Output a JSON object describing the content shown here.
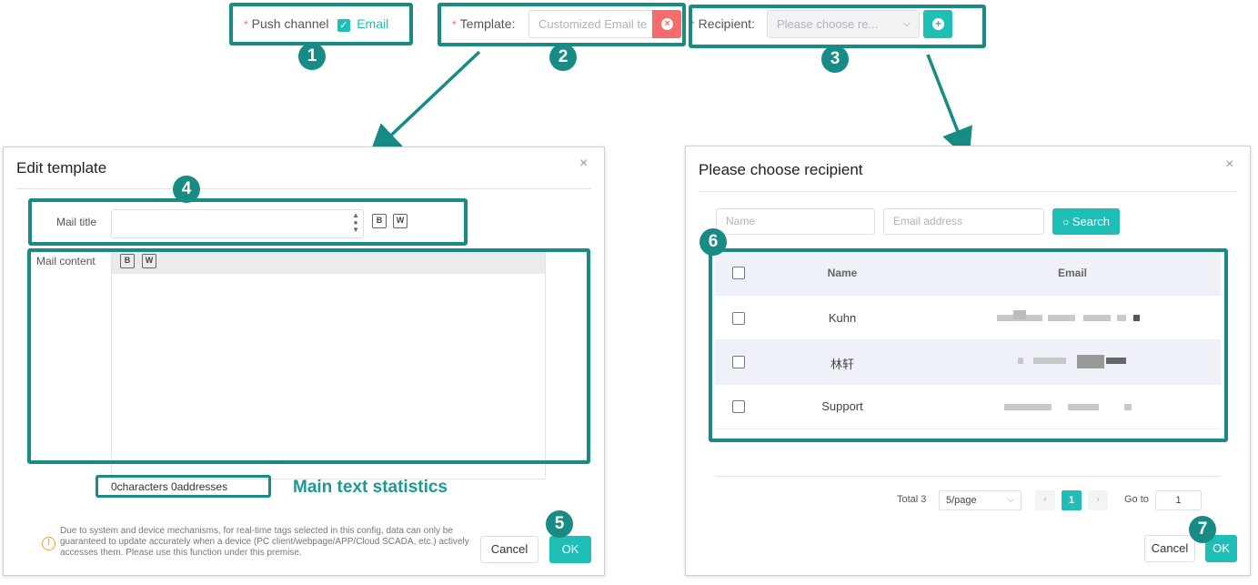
{
  "top": {
    "push_channel_label": "Push channel",
    "email_option": "Email",
    "template_label": "Template:",
    "template_value": "Customized Email te",
    "recipient_label": "Recipient:",
    "recipient_placeholder": "Please choose re...",
    "required_mark": "*"
  },
  "badges": [
    "1",
    "2",
    "3",
    "4",
    "5",
    "6",
    "7"
  ],
  "edit_template": {
    "title": "Edit template",
    "mail_title_label": "Mail title",
    "mail_content_label": "Mail content",
    "stats_text": "0characters 0addresses",
    "stats_caption": "Main text statistics",
    "notice": "Due to system and device mechanisms, for real-time tags selected in this config, data can only be guaranteed to update accurately when a device (PC client/webpage/APP/Cloud SCADA, etc.) actively accesses them. Please use this function under this premise.",
    "cancel": "Cancel",
    "ok": "OK",
    "close_glyph": "×",
    "tag_icon_text": "B",
    "web_icon_text": "W"
  },
  "recipient_dialog": {
    "title": "Please choose recipient",
    "name_placeholder": "Name",
    "email_placeholder": "Email address",
    "search": "Search",
    "columns": [
      "Name",
      "Email"
    ],
    "rows": [
      {
        "name": "Kuhn"
      },
      {
        "name": "林轩"
      },
      {
        "name": "Support"
      }
    ],
    "total": "Total 3",
    "page_size": "5/page",
    "current_page": "1",
    "goto_label": "Go to",
    "goto_value": "1",
    "cancel": "Cancel",
    "ok": "OK",
    "close_glyph": "×"
  },
  "colors": {
    "accent": "#1fbfb8",
    "highlight": "#178b84",
    "danger": "#f56c6c"
  }
}
